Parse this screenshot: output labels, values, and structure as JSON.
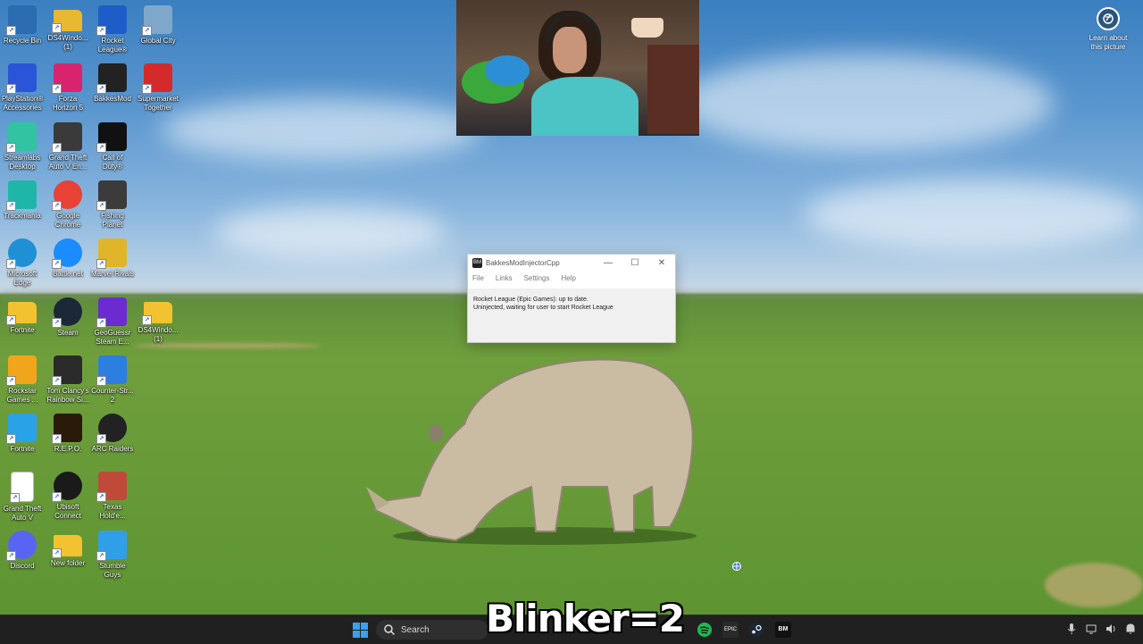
{
  "desktop": {
    "icons": [
      {
        "label": "Recycle Bin",
        "icon": "recycle-bin-icon",
        "color": "#2b6bb0"
      },
      {
        "label": "DS4Windo...\n(1)",
        "icon": "folder-icon",
        "color": "#e8b830"
      },
      {
        "label": "Rocket\nLeague®",
        "icon": "rocket-league-icon",
        "color": "#1e5cc8"
      },
      {
        "label": "Global City",
        "icon": "global-city-icon",
        "color": "#7fa7c9"
      },
      {
        "label": "PlayStation®\nAccessories",
        "icon": "playstation-icon",
        "color": "#2b55d8"
      },
      {
        "label": "Forza\nHorizon 5",
        "icon": "forza-icon",
        "color": "#d8246c"
      },
      {
        "label": "BakkesMod",
        "icon": "bakkesmod-icon",
        "color": "#222222"
      },
      {
        "label": "Supermarket\nTogether",
        "icon": "supermarket-icon",
        "color": "#d52a2a"
      },
      {
        "label": "Streamlabs\nDesktop",
        "icon": "streamlabs-icon",
        "color": "#31c3a2"
      },
      {
        "label": "Grand Theft\nAuto V En...",
        "icon": "gta-icon",
        "color": "#3a3a3a"
      },
      {
        "label": "Call of\nDuty®",
        "icon": "cod-icon",
        "color": "#111111"
      },
      {
        "label": "Trackmania",
        "icon": "trackmania-icon",
        "color": "#1fb5a8"
      },
      {
        "label": "Google\nChrome",
        "icon": "chrome-icon",
        "color": "#e84135"
      },
      {
        "label": "Fishing\nPlanet",
        "icon": "fishing-planet-icon",
        "color": "#3b3b3b"
      },
      {
        "label": "Microsoft\nEdge",
        "icon": "edge-icon",
        "color": "#1f8fd6"
      },
      {
        "label": "Battle.net",
        "icon": "battlenet-icon",
        "color": "#1a8cff"
      },
      {
        "label": "Marvel Rivals",
        "icon": "marvel-rivals-icon",
        "color": "#e0b52a"
      },
      {
        "label": "Fortnite",
        "icon": "folder-icon",
        "color": "#f2c230"
      },
      {
        "label": "Steam",
        "icon": "steam-icon",
        "color": "#1b2838"
      },
      {
        "label": "GeoGuessr\nSteam E...",
        "icon": "geoguessr-icon",
        "color": "#6b2bd0"
      },
      {
        "label": "DS4Windo...\n(1)",
        "icon": "folder-icon",
        "color": "#f2c230"
      },
      {
        "label": "Rockstar\nGames ...",
        "icon": "rockstar-icon",
        "color": "#f0a51c"
      },
      {
        "label": "Tom Clancy's\nRainbow Si...",
        "icon": "rainbow-six-icon",
        "color": "#2a2a2a"
      },
      {
        "label": "Counter-Str...\n2",
        "icon": "counter-strike-icon",
        "color": "#2c7fe0"
      },
      {
        "label": "Fortnite",
        "icon": "fortnite-icon",
        "color": "#2aa2e8"
      },
      {
        "label": "R.E.P.O.",
        "icon": "repo-icon",
        "color": "#2a1a0a"
      },
      {
        "label": "ARC Raiders",
        "icon": "arc-raiders-icon",
        "color": "#222222"
      },
      {
        "label": "Grand Theft\nAuto V",
        "icon": "file-icon",
        "color": "#ffffff"
      },
      {
        "label": "Ubisoft\nConnect",
        "icon": "ubisoft-icon",
        "color": "#1a1a1a"
      },
      {
        "label": "Texas\nHold'e...",
        "icon": "texas-holdem-icon",
        "color": "#c04a3a"
      },
      {
        "label": "Discord",
        "icon": "discord-icon",
        "color": "#5865f2"
      },
      {
        "label": "New folder",
        "icon": "folder-icon",
        "color": "#f2c230"
      },
      {
        "label": "Stumble\nGuys",
        "icon": "stumble-guys-icon",
        "color": "#2fa0e8"
      }
    ]
  },
  "learn_about": {
    "text": "Learn about\nthis picture",
    "icon": "camera-icon"
  },
  "window": {
    "title": "BakkesModInjectorCpp",
    "app_icon_text": "BM",
    "menus": [
      "File",
      "Links",
      "Settings",
      "Help"
    ],
    "status_line_1": "Rocket League (Epic Games): up to date.",
    "status_line_2": "Uninjected, waiting for user to start Rocket League",
    "controls": {
      "minimize": "—",
      "maximize": "☐",
      "close": "✕"
    }
  },
  "overlay_text": "Blinker=2",
  "taskbar": {
    "search_placeholder": "Search",
    "apps": [
      {
        "icon": "spotify-icon",
        "color": "#1db954"
      },
      {
        "icon": "epic-games-icon",
        "color": "#2a2a2a"
      },
      {
        "icon": "steam-icon",
        "color": "#1b2838"
      },
      {
        "icon": "bakkesmod-icon",
        "color": "#111111"
      }
    ],
    "tray": [
      "microphone-icon",
      "network-icon",
      "volume-icon",
      "notification-icon"
    ]
  }
}
